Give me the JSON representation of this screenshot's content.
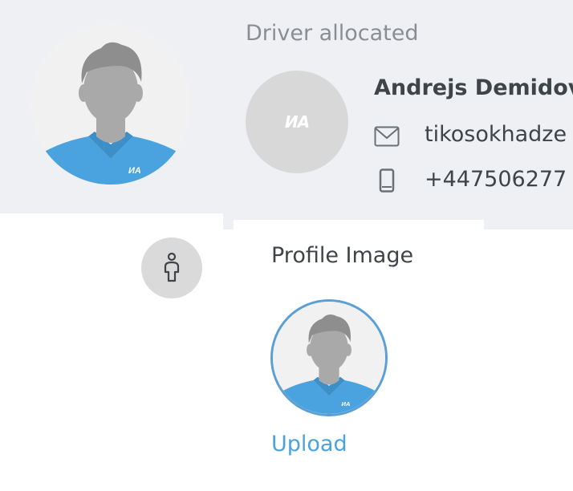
{
  "header": {
    "status_label": "Driver allocated"
  },
  "driver": {
    "name": "Andrejs Demidovs",
    "email": "tikosokhadze",
    "phone": "+447506277",
    "logo_text": "ИA",
    "avatar_icon": "driver-avatar-icon"
  },
  "profile": {
    "section_label": "Profile Image",
    "upload_label": "Upload",
    "badge_icon": "person-icon"
  },
  "icons": {
    "email": "envelope-icon",
    "phone": "mobile-phone-icon"
  },
  "colors": {
    "background_band": "#eef0f3",
    "accent_blue": "#4ba3dc",
    "shirt_blue": "#4aa3de",
    "avatar_border": "#5b9fd4",
    "silhouette_gray": "#a9a9a9",
    "text_dark": "#3f4449",
    "text_muted": "#8a8e93"
  }
}
